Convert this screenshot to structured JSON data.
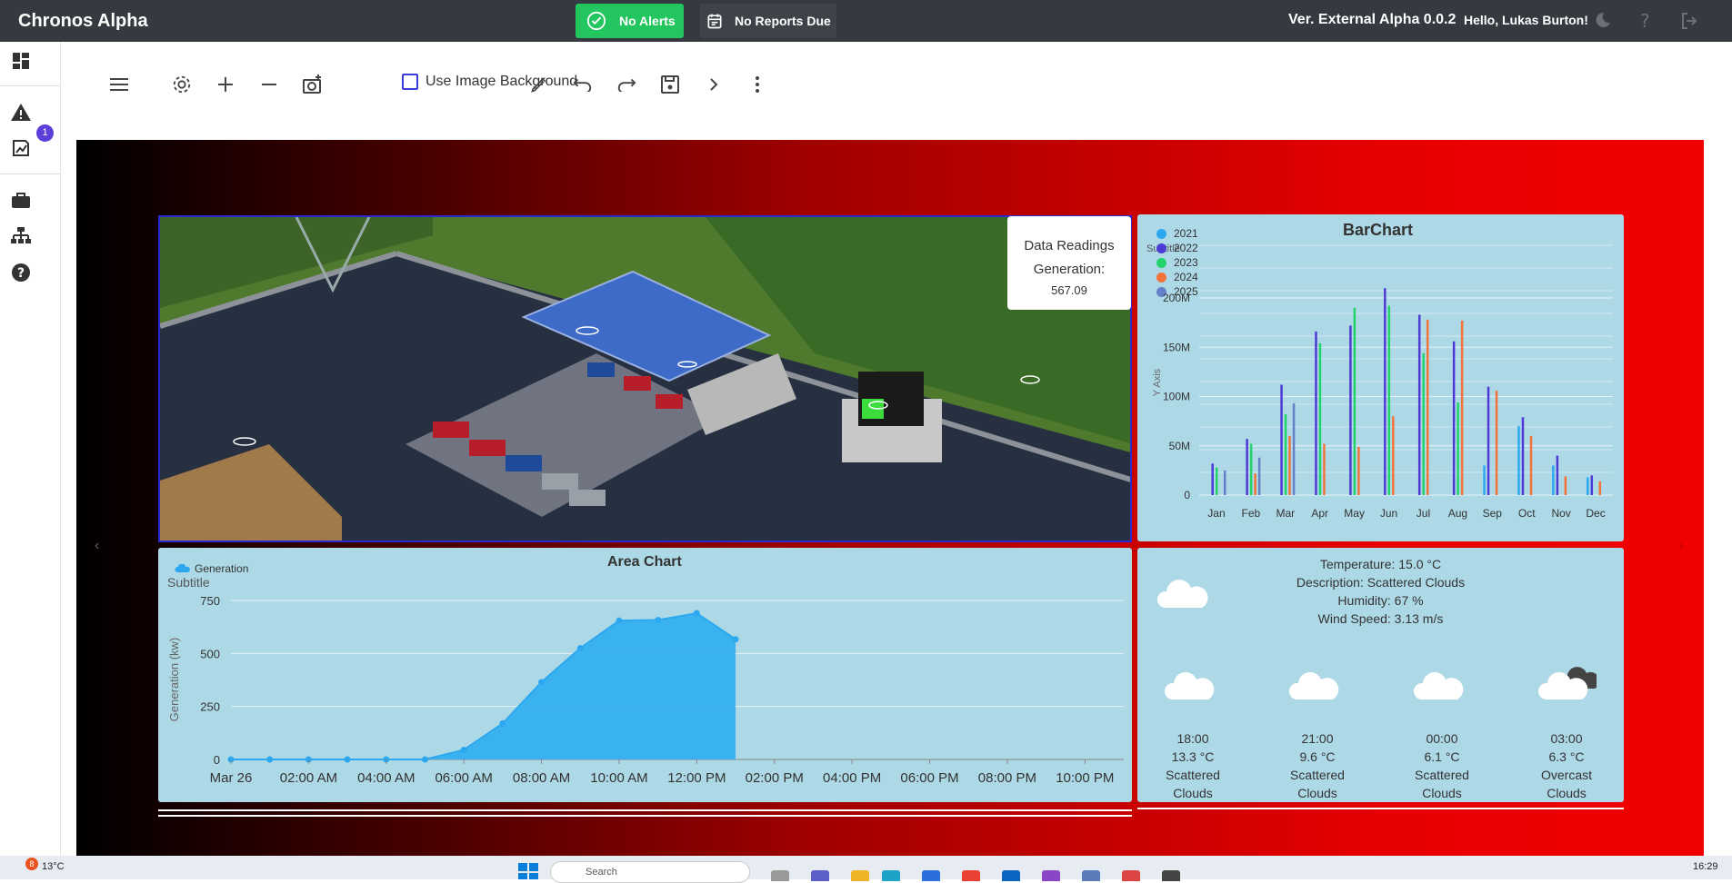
{
  "app": {
    "title": "Chronos Alpha",
    "alerts_label": "No Alerts",
    "reports_label": "No Reports Due",
    "version": "Ver. External Alpha 0.0.2",
    "greeting": "Hello, Lukas Burton!"
  },
  "sidebar": {
    "items": [
      "dashboard-icon",
      "warning-icon",
      "reports-icon",
      "briefcase-icon",
      "network-icon",
      "help-circle-icon"
    ],
    "badge_count": "1"
  },
  "toolbar": {
    "checkbox_label": "Use Image Background",
    "checked": false
  },
  "scene": {
    "tooltip_title": "Data Readings",
    "tooltip_label": "Generation:",
    "tooltip_value": "567.09"
  },
  "bar_chart": {
    "title": "BarChart",
    "subtitle": "Subtitle",
    "ylabel": "Y Axis",
    "y_ticks": [
      "0",
      "50M",
      "100M",
      "150M",
      "200M"
    ],
    "colors": {
      "2021": "#2ca8f0",
      "2022": "#4e3bd6",
      "2023": "#22d36b",
      "2024": "#f4733a",
      "2025": "#6380c9"
    },
    "legend": [
      "2021",
      "2022",
      "2023",
      "2024",
      "2025"
    ],
    "chart_data": {
      "type": "bar",
      "categories": [
        "Jan",
        "Feb",
        "Mar",
        "Apr",
        "May",
        "Jun",
        "Jul",
        "Aug",
        "Sep",
        "Oct",
        "Nov",
        "Dec"
      ],
      "ylim": [
        0,
        200000000
      ],
      "series": [
        {
          "name": "2021",
          "values": [
            0,
            0,
            0,
            0,
            0,
            0,
            0,
            0,
            30000000,
            70000000,
            30000000,
            18000000
          ]
        },
        {
          "name": "2022",
          "values": [
            32000000,
            57000000,
            112000000,
            166000000,
            172000000,
            210000000,
            183000000,
            156000000,
            110000000,
            79000000,
            40000000,
            20000000
          ]
        },
        {
          "name": "2023",
          "values": [
            28000000,
            52000000,
            82000000,
            154000000,
            190000000,
            192000000,
            144000000,
            94000000,
            0,
            0,
            0,
            0
          ]
        },
        {
          "name": "2024",
          "values": [
            0,
            22000000,
            60000000,
            52000000,
            49000000,
            80000000,
            178000000,
            177000000,
            106000000,
            60000000,
            19000000,
            14000000
          ]
        },
        {
          "name": "2025",
          "values": [
            25000000,
            38000000,
            93000000,
            0,
            0,
            0,
            0,
            0,
            0,
            0,
            0,
            0
          ]
        }
      ]
    }
  },
  "area_chart": {
    "title": "Area Chart",
    "subtitle": "Subtitle",
    "legend": "Generation",
    "ylabel": "Generation (kw)",
    "y_ticks": [
      "0",
      "250",
      "500",
      "750"
    ],
    "chart_data": {
      "type": "area",
      "x_labels": [
        "Mar 26",
        "02:00 AM",
        "04:00 AM",
        "06:00 AM",
        "08:00 AM",
        "10:00 AM",
        "12:00 PM",
        "02:00 PM",
        "04:00 PM",
        "06:00 PM",
        "08:00 PM",
        "10:00 PM"
      ],
      "ylim": [
        0,
        750
      ],
      "series": [
        {
          "name": "Generation",
          "x": [
            "00:00",
            "01:00",
            "02:00",
            "03:00",
            "04:00",
            "05:00",
            "06:00",
            "07:00",
            "08:00",
            "09:00",
            "10:00",
            "11:00",
            "12:00",
            "13:00"
          ],
          "values": [
            0,
            0,
            0,
            0,
            0,
            0,
            45,
            170,
            365,
            525,
            655,
            658,
            690,
            567
          ]
        }
      ]
    }
  },
  "weather": {
    "current": [
      "Temperature: 15.0 °C",
      "Description: Scattered Clouds",
      "Humidity: 67 %",
      "Wind Speed: 3.13 m/s"
    ],
    "forecast": [
      {
        "time": "18:00",
        "temp": "13.3 °C",
        "desc1": "Scattered",
        "desc2": "Clouds",
        "icon": "cloud-icon"
      },
      {
        "time": "21:00",
        "temp": "9.6 °C",
        "desc1": "Scattered",
        "desc2": "Clouds",
        "icon": "cloud-icon"
      },
      {
        "time": "00:00",
        "temp": "6.1 °C",
        "desc1": "Scattered",
        "desc2": "Clouds",
        "icon": "cloud-icon"
      },
      {
        "time": "03:00",
        "temp": "6.3 °C",
        "desc1": "Overcast",
        "desc2": "Clouds",
        "icon": "overcast-cloud-icon"
      }
    ]
  },
  "taskbar": {
    "weather_temp": "13°C",
    "weather_badge": "8",
    "search_label": "Search",
    "clock": "16:29"
  }
}
